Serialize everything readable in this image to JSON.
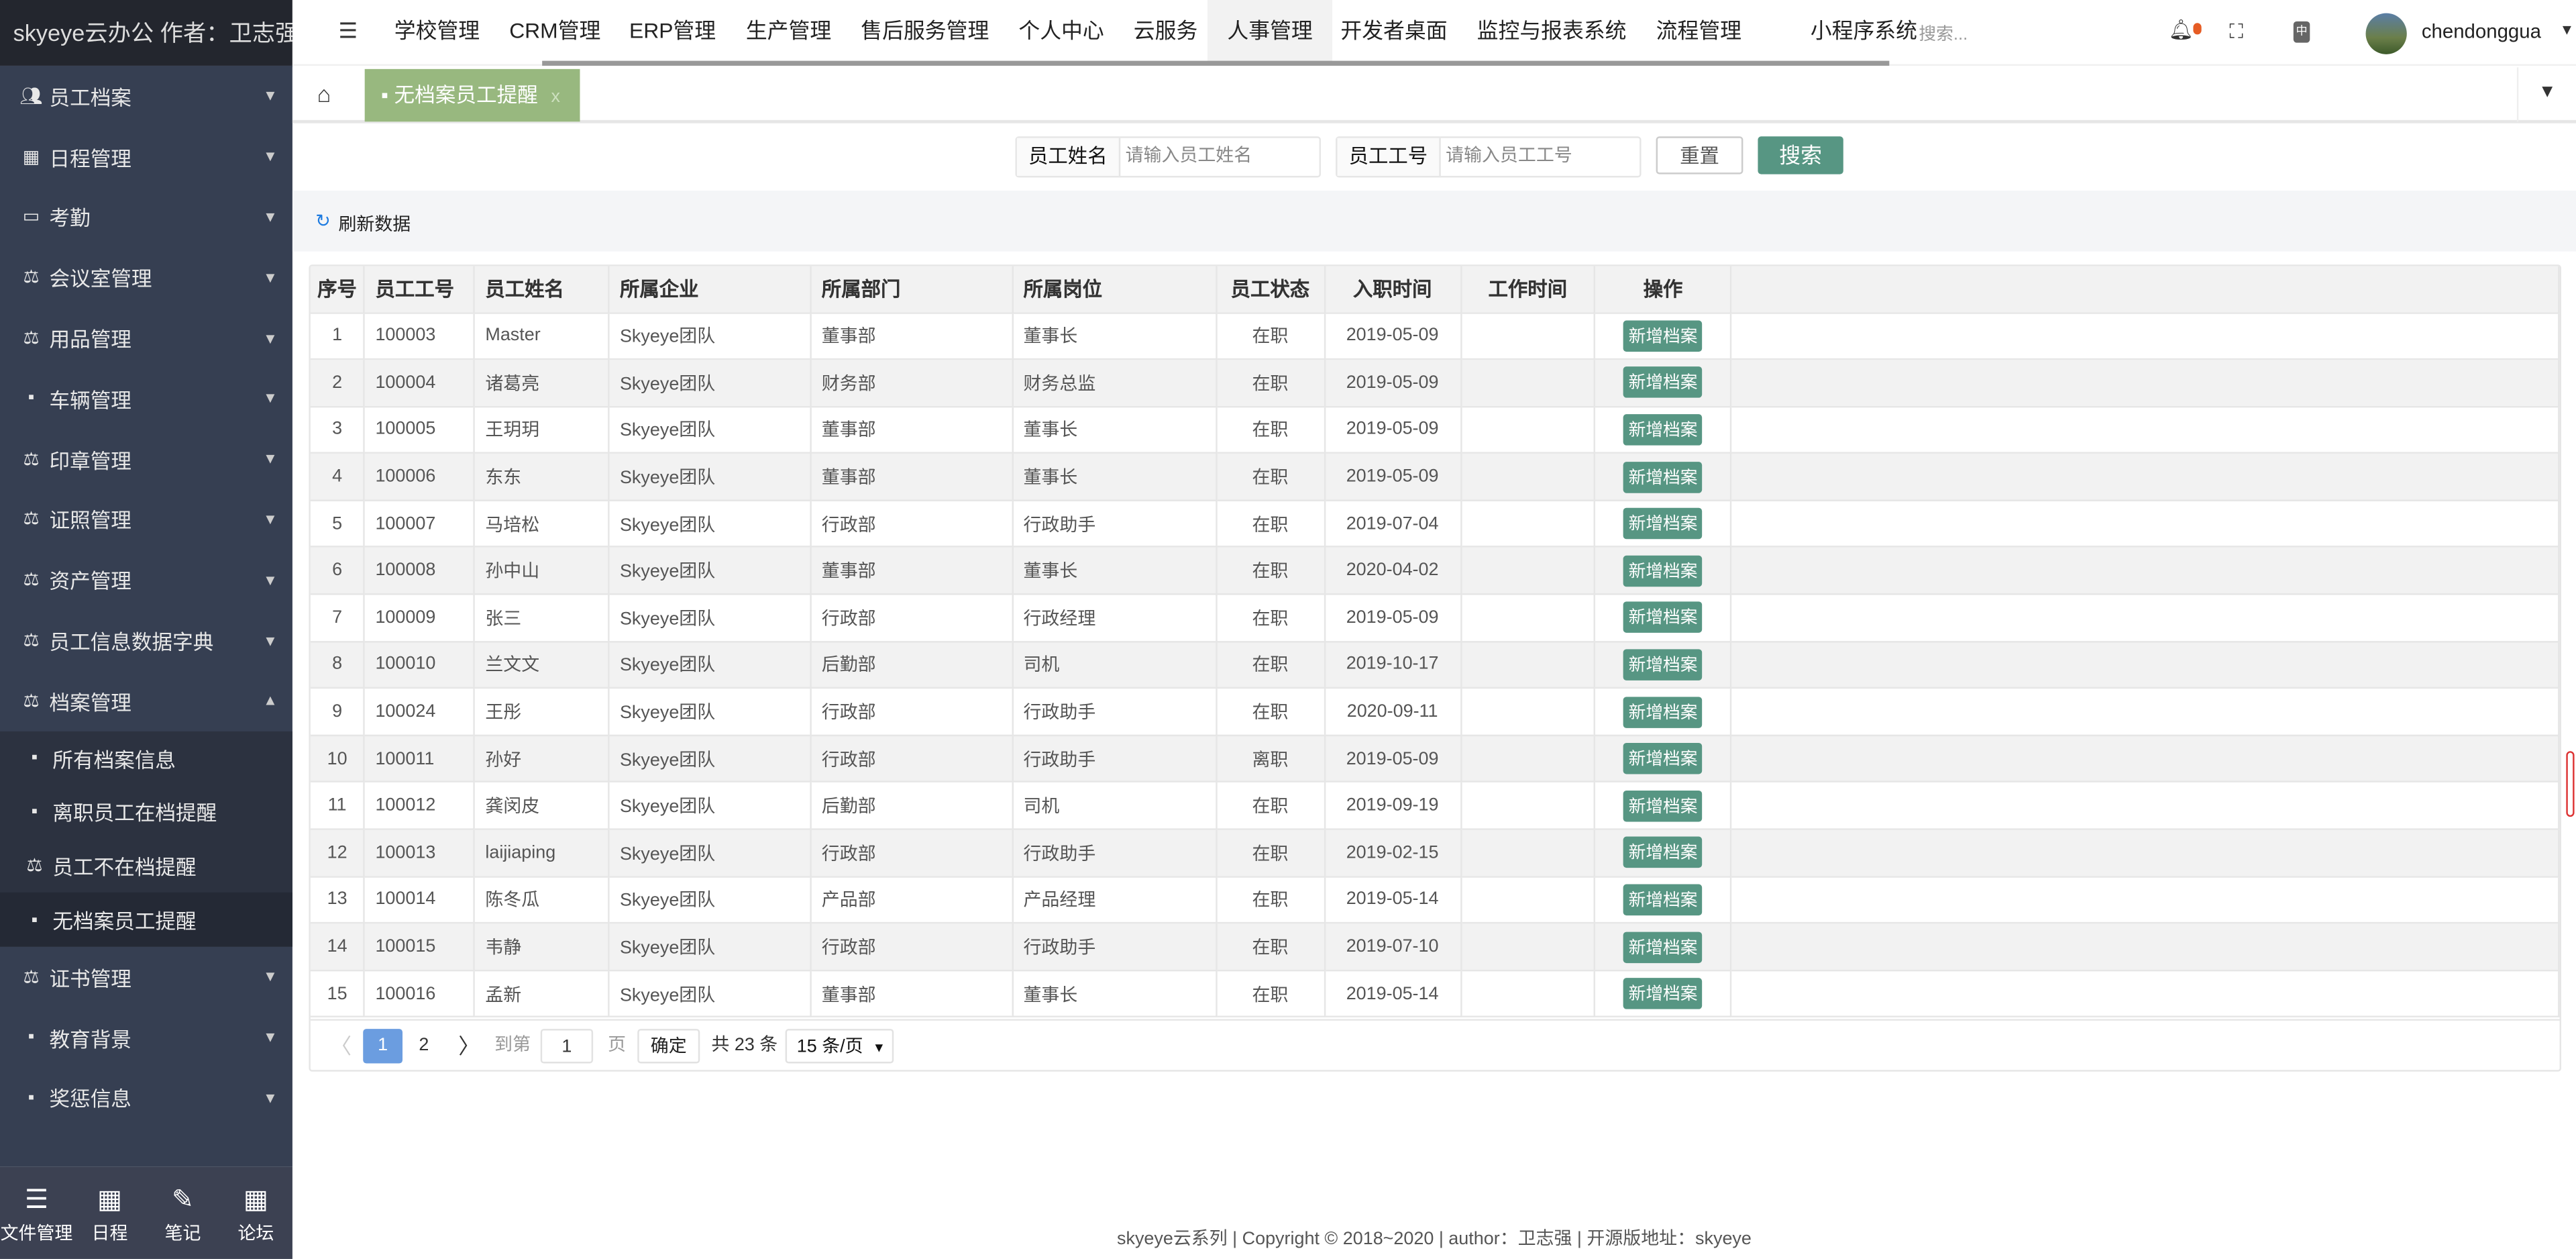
{
  "app": {
    "title": "skyeye云办公 作者：卫志强"
  },
  "sidebar": {
    "items": [
      {
        "label": "员工档案",
        "icon": "users-icon"
      },
      {
        "label": "日程管理",
        "icon": "grid-icon"
      },
      {
        "label": "考勤",
        "icon": "card-icon"
      },
      {
        "label": "会议室管理",
        "icon": "scale-icon"
      },
      {
        "label": "用品管理",
        "icon": "scale-icon"
      },
      {
        "label": "车辆管理",
        "icon": "doc-icon"
      },
      {
        "label": "印章管理",
        "icon": "scale-icon"
      },
      {
        "label": "证照管理",
        "icon": "scale-icon"
      },
      {
        "label": "资产管理",
        "icon": "scale-icon"
      },
      {
        "label": "员工信息数据字典",
        "icon": "scale-icon"
      },
      {
        "label": "档案管理",
        "icon": "scale-icon",
        "expanded": true
      }
    ],
    "sub_items": [
      {
        "label": "所有档案信息"
      },
      {
        "label": "离职员工在档提醒"
      },
      {
        "label": "员工不在档提醒"
      },
      {
        "label": "无档案员工提醒",
        "active": true
      }
    ],
    "items_after": [
      {
        "label": "证书管理"
      },
      {
        "label": "教育背景"
      },
      {
        "label": "奖惩信息"
      }
    ],
    "bottom": [
      {
        "label": "文件管理",
        "icon": "list-icon"
      },
      {
        "label": "日程",
        "icon": "calendar-icon"
      },
      {
        "label": "笔记",
        "icon": "edit-icon"
      },
      {
        "label": "论坛",
        "icon": "calendar-icon"
      }
    ]
  },
  "topnav": {
    "items": [
      "学校管理",
      "CRM管理",
      "ERP管理",
      "生产管理",
      "售后服务管理",
      "个人中心",
      "云服务",
      "人事管理",
      "开发者桌面",
      "监控与报表系统",
      "流程管理",
      "小程序系统"
    ],
    "active": "人事管理",
    "search_placeholder": "搜索...",
    "user": "chendonggua",
    "notification_dot_color": "#e65c24"
  },
  "tabs": {
    "active": "无档案员工提醒",
    "close": "x"
  },
  "search": {
    "name_label": "员工姓名",
    "name_placeholder": "请输入员工姓名",
    "no_label": "员工工号",
    "no_placeholder": "请输入员工工号",
    "reset": "重置",
    "search": "搜索",
    "refresh": "刷新数据"
  },
  "table": {
    "columns": [
      "序号",
      "员工工号",
      "员工姓名",
      "所属企业",
      "所属部门",
      "所属岗位",
      "员工状态",
      "入职时间",
      "工作时间",
      "操作"
    ],
    "action_label": "新增档案",
    "rows": [
      [
        "1",
        "100003",
        "Master",
        "Skyeye团队",
        "董事部",
        "董事长",
        "在职",
        "2019-05-09",
        ""
      ],
      [
        "2",
        "100004",
        "诸葛亮",
        "Skyeye团队",
        "财务部",
        "财务总监",
        "在职",
        "2019-05-09",
        ""
      ],
      [
        "3",
        "100005",
        "王玥玥",
        "Skyeye团队",
        "董事部",
        "董事长",
        "在职",
        "2019-05-09",
        ""
      ],
      [
        "4",
        "100006",
        "东东",
        "Skyeye团队",
        "董事部",
        "董事长",
        "在职",
        "2019-05-09",
        ""
      ],
      [
        "5",
        "100007",
        "马培松",
        "Skyeye团队",
        "行政部",
        "行政助手",
        "在职",
        "2019-07-04",
        ""
      ],
      [
        "6",
        "100008",
        "孙中山",
        "Skyeye团队",
        "董事部",
        "董事长",
        "在职",
        "2020-04-02",
        ""
      ],
      [
        "7",
        "100009",
        "张三",
        "Skyeye团队",
        "行政部",
        "行政经理",
        "在职",
        "2019-05-09",
        ""
      ],
      [
        "8",
        "100010",
        "兰文文",
        "Skyeye团队",
        "后勤部",
        "司机",
        "在职",
        "2019-10-17",
        ""
      ],
      [
        "9",
        "100024",
        "王彤",
        "Skyeye团队",
        "行政部",
        "行政助手",
        "在职",
        "2020-09-11",
        ""
      ],
      [
        "10",
        "100011",
        "孙好",
        "Skyeye团队",
        "行政部",
        "行政助手",
        "离职",
        "2019-05-09",
        ""
      ],
      [
        "11",
        "100012",
        "龚闵皮",
        "Skyeye团队",
        "后勤部",
        "司机",
        "在职",
        "2019-09-19",
        ""
      ],
      [
        "12",
        "100013",
        "laijiaping",
        "Skyeye团队",
        "行政部",
        "行政助手",
        "在职",
        "2019-02-15",
        ""
      ],
      [
        "13",
        "100014",
        "陈冬瓜",
        "Skyeye团队",
        "产品部",
        "产品经理",
        "在职",
        "2019-05-14",
        ""
      ],
      [
        "14",
        "100015",
        "韦静",
        "Skyeye团队",
        "行政部",
        "行政助手",
        "在职",
        "2019-07-10",
        ""
      ],
      [
        "15",
        "100016",
        "孟新",
        "Skyeye团队",
        "董事部",
        "董事长",
        "在职",
        "2019-05-14",
        ""
      ]
    ]
  },
  "pagination": {
    "pages": [
      "1",
      "2"
    ],
    "current": "1",
    "goto_label": "到第",
    "goto_value": "1",
    "page_unit": "页",
    "confirm": "确定",
    "total": "共 23 条",
    "page_size": "15 条/页"
  },
  "footer": "skyeye云系列 | Copyright © 2018~2020 | author：卫志强 | 开源版地址：skyeye",
  "colors": {
    "sidebar": "#363f52",
    "accent": "#579683",
    "tab_active": "#98b87f",
    "page_active": "#6b9de0"
  }
}
